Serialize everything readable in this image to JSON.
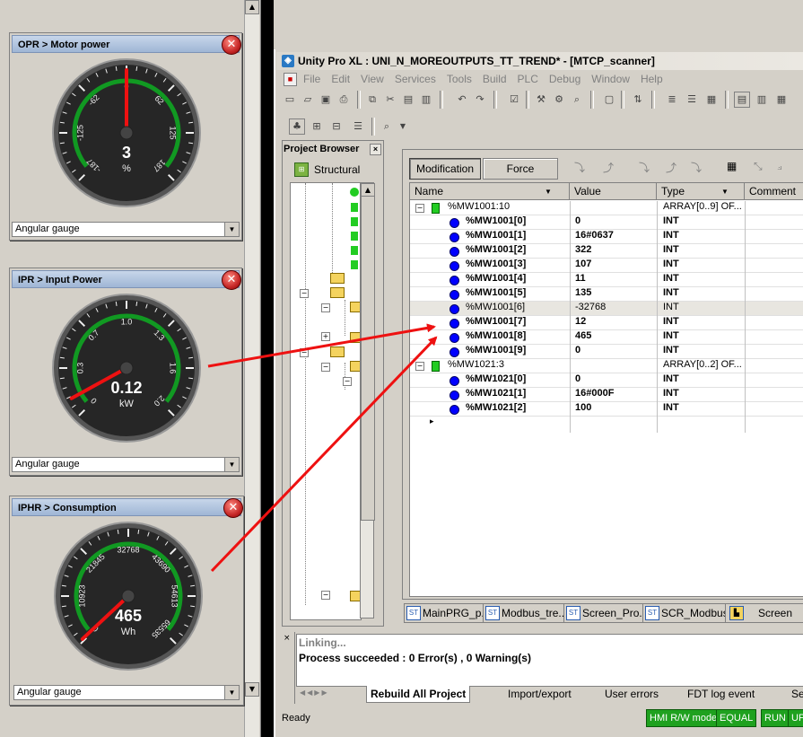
{
  "left_panel": {
    "widgets": [
      {
        "title": "OPR > Motor power",
        "close": "✕",
        "value": "3",
        "unit": "%",
        "ticks": [
          "-187",
          "-125",
          "-62",
          "0",
          "62",
          "125",
          "187"
        ],
        "needle_fraction": 0.5,
        "dropdown": "Angular gauge"
      },
      {
        "title": "IPR > Input Power",
        "close": "✕",
        "value": "0.12",
        "unit": "kW",
        "ticks": [
          "0",
          "0.3",
          "0.7",
          "1.0",
          "1.3",
          "1.6",
          "2.0"
        ],
        "needle_fraction": 0.06,
        "dropdown": "Angular gauge"
      },
      {
        "title": "IPHR > Consumption",
        "close": "✕",
        "value": "465",
        "unit": "Wh",
        "ticks": [
          "0",
          "10923",
          "21845",
          "32768",
          "43690",
          "54613",
          "65535"
        ],
        "needle_fraction": 0.007,
        "dropdown": "Angular gauge"
      }
    ]
  },
  "window": {
    "title": "Unity Pro XL : UNI_N_MOREOUTPUTS_TT_TREND* - [MTCP_scanner]",
    "menu": [
      "File",
      "Edit",
      "View",
      "Services",
      "Tools",
      "Build",
      "PLC",
      "Debug",
      "Window",
      "Help"
    ]
  },
  "project_browser": {
    "title": "Project Browser",
    "view": "Structural"
  },
  "variables": {
    "buttons": [
      "Modification",
      "Force"
    ],
    "headers": [
      "Name",
      "Value",
      "Type",
      "Comment"
    ],
    "rows": [
      {
        "name": "%MW1001:10",
        "value": "",
        "type": "ARRAY[0..9] OF...",
        "kind": "array",
        "expand": "−"
      },
      {
        "name": "%MW1001[0]",
        "value": "0",
        "type": "INT",
        "kind": "item"
      },
      {
        "name": "%MW1001[1]",
        "value": "16#0637",
        "type": "INT",
        "kind": "item"
      },
      {
        "name": "%MW1001[2]",
        "value": "322",
        "type": "INT",
        "kind": "item"
      },
      {
        "name": "%MW1001[3]",
        "value": "107",
        "type": "INT",
        "kind": "item"
      },
      {
        "name": "%MW1001[4]",
        "value": "11",
        "type": "INT",
        "kind": "item"
      },
      {
        "name": "%MW1001[5]",
        "value": "135",
        "type": "INT",
        "kind": "item"
      },
      {
        "name": "%MW1001[6]",
        "value": "-32768",
        "type": "INT",
        "kind": "selected"
      },
      {
        "name": "%MW1001[7]",
        "value": "12",
        "type": "INT",
        "kind": "item"
      },
      {
        "name": "%MW1001[8]",
        "value": "465",
        "type": "INT",
        "kind": "item"
      },
      {
        "name": "%MW1001[9]",
        "value": "0",
        "type": "INT",
        "kind": "item"
      },
      {
        "name": "%MW1021:3",
        "value": "",
        "type": "ARRAY[0..2] OF...",
        "kind": "array",
        "expand": "−"
      },
      {
        "name": "%MW1021[0]",
        "value": "0",
        "type": "INT",
        "kind": "item"
      },
      {
        "name": "%MW1021[1]",
        "value": "16#000F",
        "type": "INT",
        "kind": "item"
      },
      {
        "name": "%MW1021[2]",
        "value": "100",
        "type": "INT",
        "kind": "item"
      }
    ]
  },
  "doc_tabs": [
    "MainPRG_p...",
    "Modbus_tre...",
    "Screen_Pro...",
    "SCR_Modbus",
    "Screen"
  ],
  "output": {
    "lines": [
      "Linking...",
      "Process succeeded  : 0 Error(s) , 0 Warning(s)"
    ],
    "tabs": [
      "Rebuild All Project",
      "Import/export",
      "User errors",
      "FDT log event",
      "Se"
    ]
  },
  "status": {
    "text": "Ready",
    "badges": [
      "HMI R/W mode",
      "EQUAL",
      "RUN",
      "UP"
    ]
  },
  "colors": {
    "arrow": "#ee1111",
    "gauge_arc": "#119922",
    "needle": "#ee1111",
    "status_badge": "#1fa11f"
  }
}
